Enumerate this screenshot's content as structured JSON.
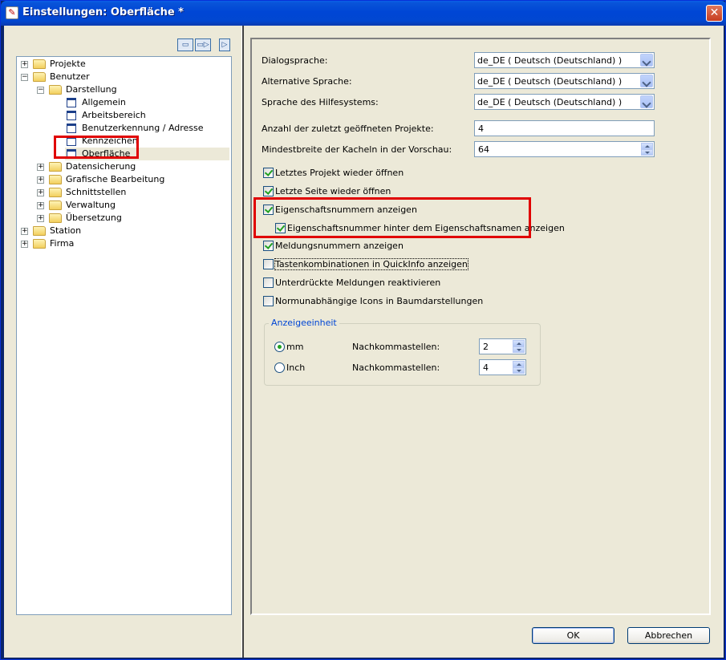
{
  "window": {
    "title": "Einstellungen: Oberfläche *",
    "close_label": "✕"
  },
  "toolbar": {
    "btn1_label": "▭",
    "btn2_label": "▭▷",
    "btn3_label": "▷"
  },
  "tree": {
    "nodes": [
      {
        "label": "Projekte",
        "expander": "+"
      },
      {
        "label": "Benutzer",
        "expander": "−"
      },
      {
        "label": "Darstellung",
        "expander": "−"
      },
      {
        "label": "Allgemein"
      },
      {
        "label": "Arbeitsbereich"
      },
      {
        "label": "Benutzerkennung / Adresse"
      },
      {
        "label": "Kennzeichen"
      },
      {
        "label": "Oberfläche"
      },
      {
        "label": "Datensicherung",
        "expander": "+"
      },
      {
        "label": "Grafische Bearbeitung",
        "expander": "+"
      },
      {
        "label": "Schnittstellen",
        "expander": "+"
      },
      {
        "label": "Verwaltung",
        "expander": "+"
      },
      {
        "label": "Übersetzung",
        "expander": "+"
      },
      {
        "label": "Station",
        "expander": "+"
      },
      {
        "label": "Firma",
        "expander": "+"
      }
    ]
  },
  "form": {
    "dialog_language": {
      "label": "Dialogsprache:",
      "value": "de_DE ( Deutsch (Deutschland) )"
    },
    "alt_language": {
      "label": "Alternative Sprache:",
      "value": "de_DE ( Deutsch (Deutschland) )"
    },
    "help_language": {
      "label": "Sprache des Hilfesystems:",
      "value": "de_DE ( Deutsch (Deutschland) )"
    },
    "recent_projects": {
      "label": "Anzahl der zuletzt geöffneten Projekte:",
      "value": "4"
    },
    "tile_width": {
      "label": "Mindestbreite der Kacheln in der Vorschau:",
      "value": "64"
    },
    "checkboxes": [
      {
        "label": "Letztes Projekt wieder öffnen",
        "checked": true
      },
      {
        "label": "Letzte Seite wieder öffnen",
        "checked": true
      },
      {
        "label": "Eigenschaftsnummern anzeigen",
        "checked": true
      },
      {
        "label": "Eigenschaftsnummer hinter dem Eigenschaftsnamen anzeigen",
        "checked": true
      },
      {
        "label": "Meldungsnummern anzeigen",
        "checked": true
      },
      {
        "label": "Tastenkombinationen in QuickInfo anzeigen",
        "checked": false
      },
      {
        "label": "Unterdrückte Meldungen reaktivieren",
        "checked": false
      },
      {
        "label": "Normunabhängige Icons in Baumdarstellungen",
        "checked": false
      }
    ],
    "unit_group": {
      "title": "Anzeigeeinheit",
      "mm": {
        "label": "mm",
        "selected": true,
        "decimals_label": "Nachkommastellen:",
        "decimals": "2"
      },
      "inch": {
        "label": "Inch",
        "selected": false,
        "decimals_label": "Nachkommastellen:",
        "decimals": "4"
      }
    }
  },
  "buttons": {
    "ok": "OK",
    "cancel": "Abbrechen"
  },
  "colors": {
    "highlight": "#E00000",
    "titlebar": "#0046D5",
    "face": "#ECE9D8"
  }
}
